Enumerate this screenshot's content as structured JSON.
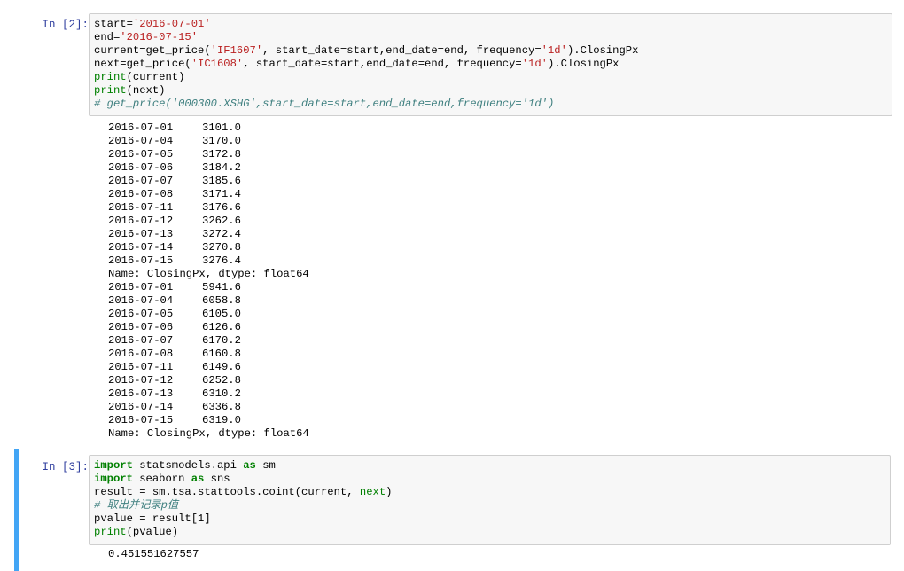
{
  "cells": [
    {
      "prompt": "In [2]:",
      "code": [
        [
          {
            "t": "start="
          },
          {
            "t": "'2016-07-01'",
            "c": "str"
          }
        ],
        [
          {
            "t": "end="
          },
          {
            "t": "'2016-07-15'",
            "c": "str"
          }
        ],
        [
          {
            "t": "current=get_price("
          },
          {
            "t": "'IF1607'",
            "c": "str"
          },
          {
            "t": ", start_date=start,end_date=end, frequency="
          },
          {
            "t": "'1d'",
            "c": "str"
          },
          {
            "t": ").ClosingPx"
          }
        ],
        [
          {
            "t": "next=get_price("
          },
          {
            "t": "'IC1608'",
            "c": "str"
          },
          {
            "t": ", start_date=start,end_date=end, frequency="
          },
          {
            "t": "'1d'",
            "c": "str"
          },
          {
            "t": ").ClosingPx"
          }
        ],
        [
          {
            "t": "print",
            "c": "bi"
          },
          {
            "t": "(current)"
          }
        ],
        [
          {
            "t": "print",
            "c": "bi"
          },
          {
            "t": "(next)"
          }
        ],
        [
          {
            "t": "# get_price('000300.XSHG',start_date=start,end_date=end,frequency='1d')",
            "c": "cm"
          }
        ]
      ],
      "output": [
        [
          "2016-07-01",
          "3101.0"
        ],
        [
          "2016-07-04",
          "3170.0"
        ],
        [
          "2016-07-05",
          "3172.8"
        ],
        [
          "2016-07-06",
          "3184.2"
        ],
        [
          "2016-07-07",
          "3185.6"
        ],
        [
          "2016-07-08",
          "3171.4"
        ],
        [
          "2016-07-11",
          "3176.6"
        ],
        [
          "2016-07-12",
          "3262.6"
        ],
        [
          "2016-07-13",
          "3272.4"
        ],
        [
          "2016-07-14",
          "3270.8"
        ],
        [
          "2016-07-15",
          "3276.4"
        ],
        [
          "Name: ClosingPx, dtype: float64"
        ],
        [
          "2016-07-01",
          "5941.6"
        ],
        [
          "2016-07-04",
          "6058.8"
        ],
        [
          "2016-07-05",
          "6105.0"
        ],
        [
          "2016-07-06",
          "6126.6"
        ],
        [
          "2016-07-07",
          "6170.2"
        ],
        [
          "2016-07-08",
          "6160.8"
        ],
        [
          "2016-07-11",
          "6149.6"
        ],
        [
          "2016-07-12",
          "6252.8"
        ],
        [
          "2016-07-13",
          "6310.2"
        ],
        [
          "2016-07-14",
          "6336.8"
        ],
        [
          "2016-07-15",
          "6319.0"
        ],
        [
          "Name: ClosingPx, dtype: float64"
        ]
      ]
    },
    {
      "prompt": "In [3]:",
      "code": [
        [
          {
            "t": "import",
            "c": "kw"
          },
          {
            "t": " statsmodels.api "
          },
          {
            "t": "as",
            "c": "kw"
          },
          {
            "t": " sm"
          }
        ],
        [
          {
            "t": "import",
            "c": "kw"
          },
          {
            "t": " seaborn "
          },
          {
            "t": "as",
            "c": "kw"
          },
          {
            "t": " sns"
          }
        ],
        [
          {
            "t": "result = sm.tsa.stattools.coint(current, "
          },
          {
            "t": "next",
            "c": "bi"
          },
          {
            "t": ")"
          }
        ],
        [
          {
            "t": "# 取出并记录p值",
            "c": "cm"
          }
        ],
        [
          {
            "t": "pvalue = result["
          },
          {
            "t": "1"
          },
          {
            "t": "]"
          }
        ],
        [
          {
            "t": "print",
            "c": "bi"
          },
          {
            "t": "(pvalue)"
          }
        ]
      ],
      "output": [
        [
          "0.451551627557"
        ]
      ]
    }
  ]
}
